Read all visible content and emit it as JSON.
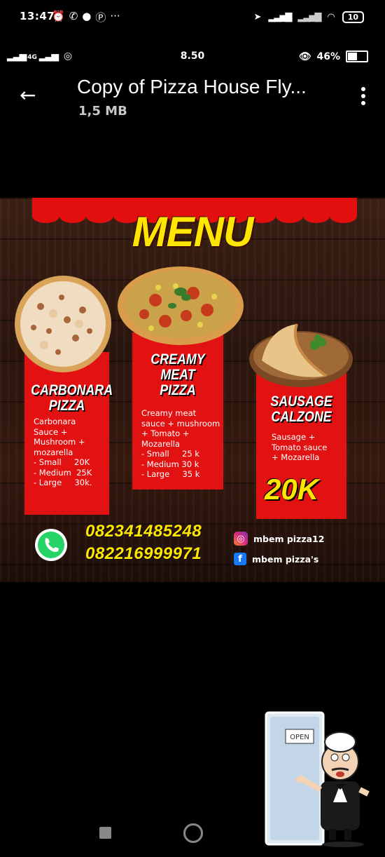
{
  "status_bar": {
    "time": "13:47",
    "battery_level": "10",
    "icons": [
      "alarm-icon",
      "whatsapp-icon",
      "chat-icon",
      "pinterest-icon",
      "more-dots"
    ]
  },
  "status_bar2": {
    "network": "4G",
    "speed": "8.50",
    "battery": "46%"
  },
  "header": {
    "title": "Copy of Pizza House Fly...",
    "file_size": "1,5 MB"
  },
  "flyer": {
    "heading": "MENU",
    "items": [
      {
        "name_line1": "CARBONARA",
        "name_line2": "PIZZA",
        "desc": [
          "Carbonara",
          "Sauce +",
          "Mushroom +",
          "mozarella"
        ],
        "prices": [
          "- Small     20K",
          "- Medium  25K",
          "- Large     30k."
        ]
      },
      {
        "name_line1": "CREAMY MEAT",
        "name_line2": "PIZZA",
        "desc": [
          "Creamy meat",
          "sauce + mushroom",
          "+ Tomato +",
          "Mozarella"
        ],
        "prices": [
          "- Small     25 k",
          "- Medium 30 k",
          "- Large     35 k"
        ]
      },
      {
        "name_line1": "SAUSAGE",
        "name_line2": "CALZONE",
        "desc": [
          "Sausage +",
          "Tomato sauce",
          "+ Mozarella"
        ],
        "price": "20K"
      }
    ],
    "phones": [
      "082341485248",
      "082216999971"
    ],
    "instagram": "mbem pizza12",
    "facebook": "mbem pizza's"
  },
  "mascot": {
    "sign": "OPEN"
  },
  "colors": {
    "accent_red": "#e31212",
    "accent_yellow": "#ffe600"
  }
}
